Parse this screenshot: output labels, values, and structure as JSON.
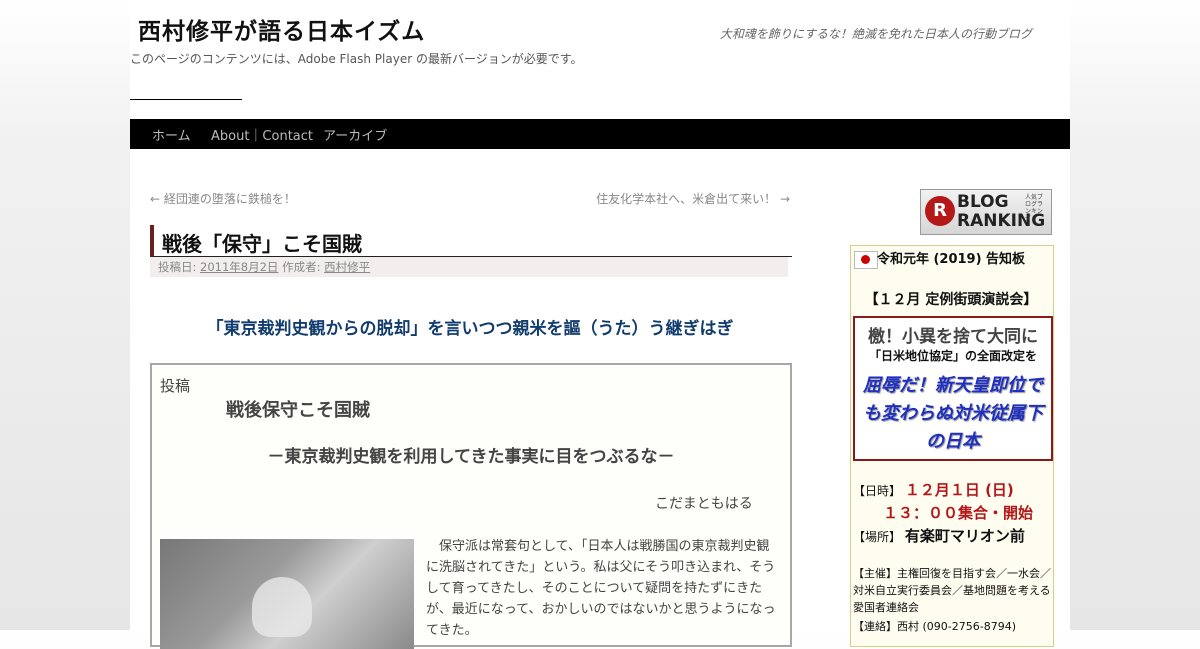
{
  "header": {
    "site_title": "西村修平が語る日本イズム",
    "site_description": "大和魂を飾りにするな！絶滅を免れた日本人の行動ブログ",
    "flash_notice": "このページのコンテンツには、Adobe Flash Player の最新バージョンが必要です。"
  },
  "nav": {
    "items": [
      {
        "label": "ホーム"
      },
      {
        "label": "About｜Contact"
      },
      {
        "label": "アーカイブ"
      }
    ]
  },
  "post_nav": {
    "previous": "← 経団連の堕落に鉄槌を！",
    "next": "住友化学本社へ、米倉出て来い！ →"
  },
  "post": {
    "title": "戦後「保守」こそ国賊",
    "meta_posted_label": "投稿日:",
    "meta_date": "2011年8月2日",
    "meta_author_label": "作成者:",
    "meta_author": "西村修平",
    "headline": "「東京裁判史観からの脱却」を言いつつ親米を謳（うた）う継ぎはぎ",
    "contribution": {
      "label": "投稿",
      "title": "戦後保守こそ国賊",
      "subtitle": "－東京裁判史観を利用してきた事実に目をつぶるな－",
      "author": "こだまともはる",
      "body_lines": [
        "　保守派は常套句として、「日本人は戦勝国の東京裁判史観",
        "に洗脳されてきた」という。私は父にそう叩き込まれ、そう",
        "して育ってきたし、そのことについて疑問を持たずにきた",
        "が、最近になって、おかしいのではないかと思うようになっ",
        "てきた。"
      ]
    }
  },
  "sidebar": {
    "ranking_badge": {
      "line1": "BLOG",
      "line2": "RANKING",
      "mark": "R",
      "tiny": "人気ブログランキング"
    },
    "notice": {
      "title": "令和元年 (2019) 告知板",
      "event": "【１２月 定例街頭演説会】",
      "slogan_main": "檄！小異を捨て大同に",
      "slogan_sub": "「日米地位協定」の全面改定を",
      "slogan_italic": "屈辱だ！新天皇即位でも変わらぬ対米従属下の日本",
      "date_label": "【日時】",
      "date_value": "１２月１日 (日)",
      "time_value": "１３：００集合・開始",
      "place_label": "【場所】",
      "place_value": "有楽町マリオン前",
      "organizer": "【主催】主権回復を目指す会／一水会／対米自立実行委員会／基地問題を考える愛国者連絡会",
      "contact": "【連絡】西村 (090-2756-8794)"
    }
  }
}
